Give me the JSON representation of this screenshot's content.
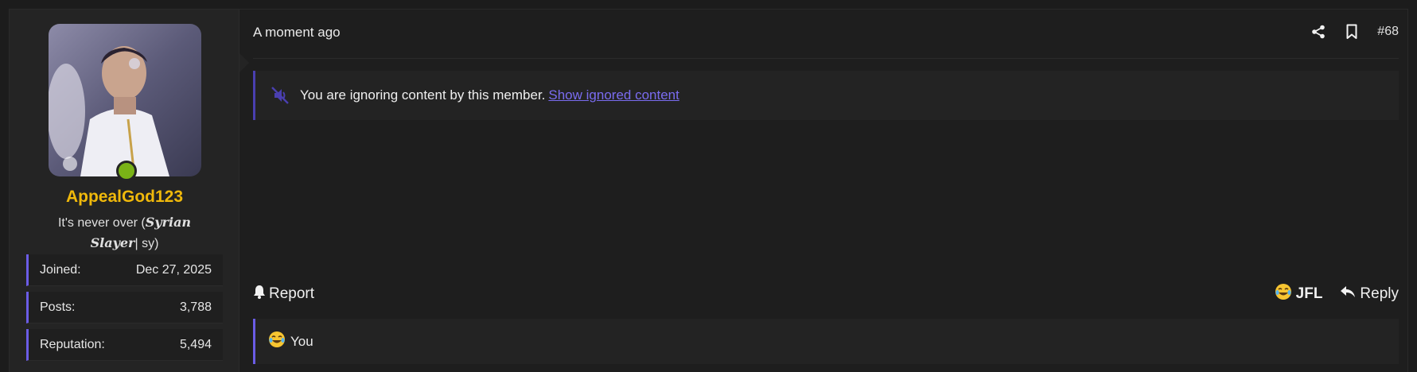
{
  "user": {
    "username": "AppealGod123",
    "title_plain_start": "It's never over (",
    "title_script": "𝑺𝒚𝒓𝒊𝒂𝒏 𝑺𝒍𝒂𝒚𝒆𝒓",
    "title_plain_end": "| sy)",
    "status": "online",
    "stats": [
      {
        "label": "Joined:",
        "value": "Dec 27, 2025"
      },
      {
        "label": "Posts:",
        "value": "3,788"
      },
      {
        "label": "Reputation:",
        "value": "5,494"
      }
    ]
  },
  "post": {
    "timestamp": "A moment ago",
    "number": "#68",
    "ignored_text": "You are ignoring content by this member.",
    "ignored_link": "Show ignored content"
  },
  "actions": {
    "report": "Report",
    "jfl": "JFL",
    "reply": "Reply"
  },
  "reactions": {
    "text": "You"
  },
  "icons": {
    "share": "share-icon",
    "bookmark": "bookmark-icon",
    "mute": "mute-icon",
    "bell": "bell-icon",
    "reply": "reply-icon",
    "jfl_emoji": "laughing-crying-emoji"
  },
  "colors": {
    "username": "#f0b90b",
    "accent": "#6b5ce6",
    "link": "#7a6cf0",
    "online": "#7ab317"
  }
}
